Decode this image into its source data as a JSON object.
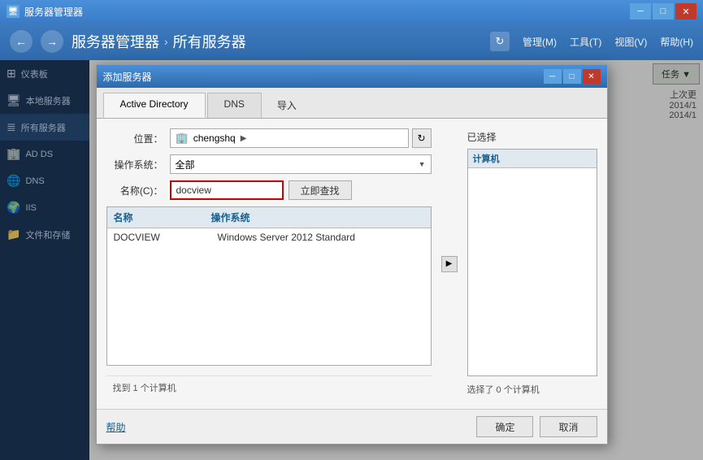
{
  "titleBar": {
    "title": "服务器管理器",
    "minBtn": "─",
    "maxBtn": "□",
    "closeBtn": "✕",
    "icon": "🖥"
  },
  "menuBar": {
    "title": "服务器管理器",
    "separator": "›",
    "subtitle": "所有服务器",
    "refresh": "↻",
    "menuItems": [
      "管理(M)",
      "工具(T)",
      "视图(V)",
      "帮助(H)"
    ],
    "back": "←",
    "forward": "→"
  },
  "sidebar": {
    "items": [
      {
        "label": "仪表板",
        "icon": "⊞"
      },
      {
        "label": "本地服务器",
        "icon": "🖥"
      },
      {
        "label": "所有服务器",
        "icon": "≣"
      },
      {
        "label": "AD DS",
        "icon": "🏢"
      },
      {
        "label": "DNS",
        "icon": "🌐"
      },
      {
        "label": "IIS",
        "icon": "🌍"
      },
      {
        "label": "文件和存储",
        "icon": "📁"
      }
    ]
  },
  "dialog": {
    "title": "添加服务器",
    "minBtn": "─",
    "maxBtn": "□",
    "closeBtn": "✕",
    "tabs": [
      {
        "label": "Active Directory",
        "active": true
      },
      {
        "label": "DNS",
        "active": false
      },
      {
        "label": "导入",
        "active": false
      }
    ],
    "form": {
      "locationLabel": "位置：",
      "locationValue": "chengshq",
      "locationArrow": "▶",
      "osLabel": "操作系统：",
      "osValue": "全部",
      "nameLabel": "名称(C)：",
      "nameValue": "docview",
      "searchBtn": "立即查找"
    },
    "resultsTable": {
      "columns": [
        "名称",
        "操作系统"
      ],
      "rows": [
        {
          "name": "DOCVIEW",
          "os": "Windows Server 2012 Standard"
        }
      ],
      "footer": "找到 1 个计算机"
    },
    "selectedPanel": {
      "label": "已选择",
      "header": "计算机",
      "footer": "选择了 0 个计算机"
    },
    "footer": {
      "helpLabel": "帮助",
      "confirmBtn": "确定",
      "cancelBtn": "取消"
    }
  },
  "rightPanel": {
    "tasks": "任务",
    "lastUpdate": "上次更",
    "dates": [
      "2014/1",
      "2014/1"
    ]
  }
}
